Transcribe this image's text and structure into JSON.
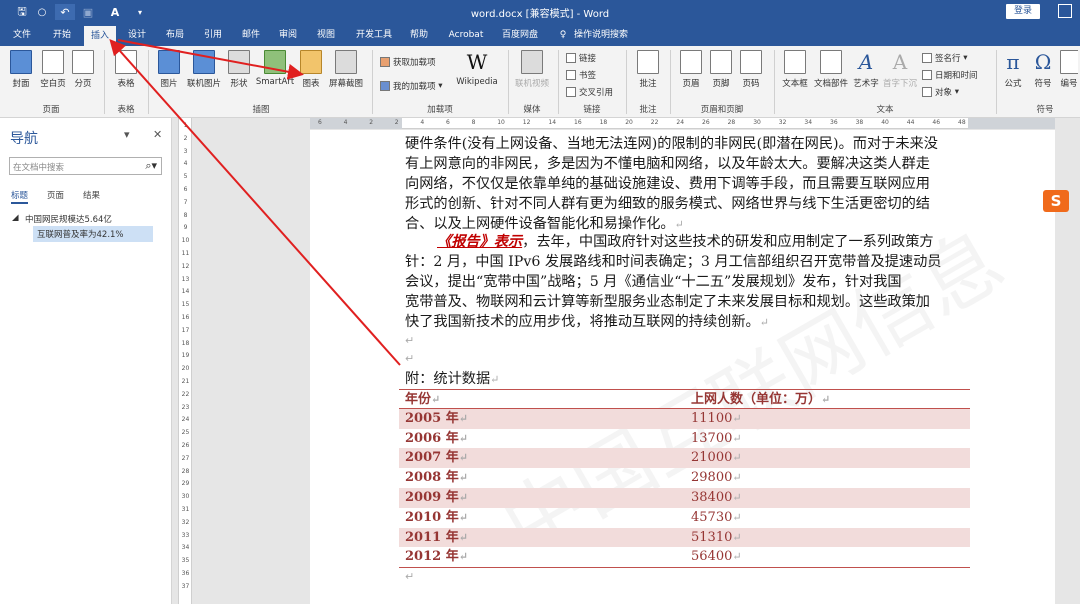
{
  "titlebar": {
    "title": "word.docx [兼容模式] - Word",
    "login": "登录",
    "save_glyph": "🖫",
    "undo_glyph": "↶",
    "font_glyph": "A"
  },
  "menu": {
    "tabs": [
      "文件",
      "开始",
      "插入",
      "设计",
      "布局",
      "引用",
      "邮件",
      "审阅",
      "视图",
      "开发工具",
      "帮助",
      "Acrobat",
      "百度网盘"
    ],
    "search_hint": "操作说明搜索",
    "active": "插入"
  },
  "ribbon": {
    "pages": {
      "cover": "封面",
      "blank": "空白页",
      "break": "分页",
      "label": "页面"
    },
    "tables": {
      "table": "表格",
      "label": "表格"
    },
    "illustrations": {
      "picture": "图片",
      "online_picture": "联机图片",
      "shapes": "形状",
      "smartart": "SmartArt",
      "chart": "图表",
      "screenshot": "屏幕截图",
      "label": "插图"
    },
    "addins": {
      "get": "获取加载项",
      "mine": "我的加载项",
      "wikipedia": "Wikipedia",
      "wiki_glyph": "W",
      "label": "加载项"
    },
    "media": {
      "online_video": "联机视频",
      "label": "媒体"
    },
    "links": {
      "link": "链接",
      "bookmark": "书签",
      "crossref": "交叉引用",
      "label": "链接"
    },
    "comments": {
      "comment": "批注",
      "label": "批注"
    },
    "header_footer": {
      "header": "页眉",
      "footer": "页脚",
      "page_number": "页码",
      "label": "页眉和页脚"
    },
    "text": {
      "textbox": "文本框",
      "quickparts": "文档部件",
      "wordart": "艺术字",
      "dropcap": "首字下沉",
      "signature": "签名行",
      "datetime": "日期和时间",
      "object": "对象",
      "label": "文本"
    },
    "symbols": {
      "equation": "公式",
      "symbol": "符号",
      "number": "编号",
      "pi_glyph": "π",
      "omega_glyph": "Ω",
      "label": "符号"
    }
  },
  "nav": {
    "title": "导航",
    "search_placeholder": "在文档中搜索",
    "tabs": [
      "标题",
      "页面",
      "结果"
    ],
    "items": [
      {
        "label": "中国网民规模达5.64亿",
        "level": 1
      },
      {
        "label": "互联网普及率为42.1%",
        "level": 2
      }
    ]
  },
  "ruler": {
    "h_numbers": [
      "6",
      "4",
      "2",
      "2",
      "4",
      "6",
      "8",
      "10",
      "12",
      "14",
      "16",
      "18",
      "20",
      "22",
      "24",
      "26",
      "28",
      "30",
      "32",
      "34",
      "36",
      "38",
      "40",
      "44",
      "46",
      "48"
    ],
    "v_numbers": [
      "1",
      "2",
      "3",
      "4",
      "5",
      "6",
      "7",
      "8",
      "9",
      "10",
      "11",
      "12",
      "13",
      "14",
      "15",
      "16",
      "17",
      "18",
      "19",
      "20",
      "21",
      "22",
      "23",
      "24",
      "25",
      "26",
      "27",
      "28",
      "29",
      "30",
      "31",
      "32",
      "33",
      "34",
      "35",
      "36",
      "37"
    ]
  },
  "document": {
    "para1": [
      "硬件条件(没有上网设备、当地无法连网)的限制的非网民(即潜在网民)。而对于未来没",
      "有上网意向的非网民，多是因为不懂电脑和网络，以及年龄太大。要解决这类人群走",
      "向网络，不仅仅是依靠单纯的基础设施建设、费用下调等手段，而且需要互联网应用",
      "形式的创新、针对不同人群有更为细致的服务模式、网络世界与线下生活更密切的结",
      "合、以及上网硬件设备智能化和易操作化。"
    ],
    "para2_em": "《报告》表示",
    "para2": [
      "，去年，中国政府针对这些技术的研发和应用制定了一系列政策方",
      "针：2 月，中国 IPv6 发展路线和时间表确定；3 月工信部组织召开宽带普及提速动员",
      "会议，提出“宽带中国”战略；5 月《通信业“十二五”发展规划》发布，针对我国",
      "宽带普及、物联网和云计算等新型服务业态制定了未来发展目标和规划。这些政策加",
      "快了我国新技术的应用步伐，将推动互联网的持续创新。"
    ],
    "appendix": "附：统计数据",
    "para_mark": "↵",
    "watermark": "中国互联网信息"
  },
  "table": {
    "headers": [
      "年份",
      "上网人数（单位：万）"
    ],
    "rows": [
      [
        "2005 年",
        "11100"
      ],
      [
        "2006 年",
        "13700"
      ],
      [
        "2007 年",
        "21000"
      ],
      [
        "2008 年",
        "29800"
      ],
      [
        "2009 年",
        "38400"
      ],
      [
        "2010 年",
        "45730"
      ],
      [
        "2011 年",
        "51310"
      ],
      [
        "2012 年",
        "56400"
      ]
    ]
  },
  "colors": {
    "accent": "#2b579a",
    "table_rule": "#c0504d",
    "table_text": "#963634",
    "table_shade": "#f2dcdb",
    "annotation": "#e02020"
  }
}
